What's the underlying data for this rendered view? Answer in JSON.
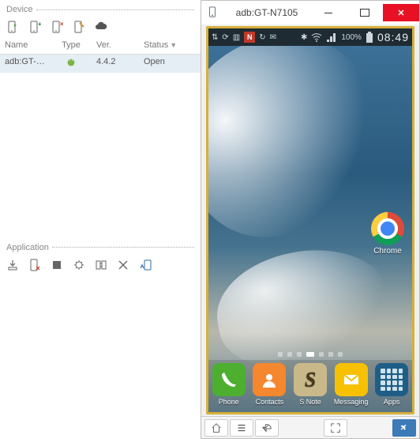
{
  "window": {
    "title": "adb:GT-N7105"
  },
  "device_panel": {
    "title": "Device",
    "columns": {
      "name": "Name",
      "type": "Type",
      "ver": "Ver.",
      "status": "Status"
    },
    "rows": [
      {
        "name": "adb:GT-N71...",
        "type": "android",
        "ver": "4.4.2",
        "status": "Open"
      }
    ]
  },
  "application_panel": {
    "title": "Application"
  },
  "phone": {
    "statusbar": {
      "battery_pct": "100%",
      "time": "08:49"
    },
    "home_apps": [
      {
        "id": "chrome",
        "label": "Chrome"
      }
    ],
    "dock": [
      {
        "id": "phone",
        "label": "Phone"
      },
      {
        "id": "contacts",
        "label": "Contacts"
      },
      {
        "id": "snote",
        "label": "S Note",
        "glyph": "S"
      },
      {
        "id": "messaging",
        "label": "Messaging"
      },
      {
        "id": "apps",
        "label": "Apps"
      }
    ],
    "page_indicator": {
      "count": 7,
      "active": 3
    }
  }
}
